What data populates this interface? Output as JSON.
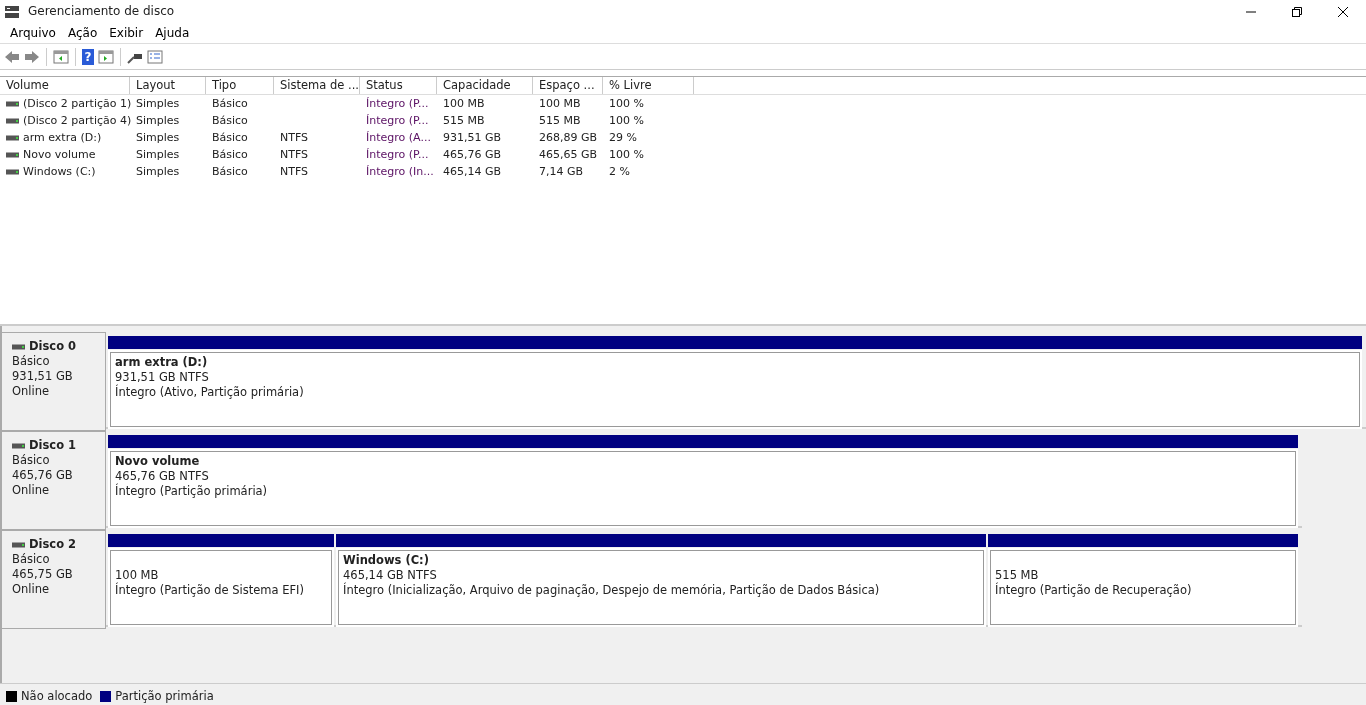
{
  "window": {
    "title": "Gerenciamento de disco"
  },
  "menu": [
    "Arquivo",
    "Ação",
    "Exibir",
    "Ajuda"
  ],
  "toolbar": {
    "help_glyph": "?"
  },
  "table": {
    "columns": [
      "Volume",
      "Layout",
      "Tipo",
      "Sistema de ...",
      "Status",
      "Capacidade",
      "Espaço ...",
      "% Livre"
    ],
    "rows": [
      [
        "(Disco 2 partição 1)",
        "Simples",
        "Básico",
        "",
        "Íntegro (P...",
        "100 MB",
        "100 MB",
        "100 %"
      ],
      [
        "(Disco 2 partição 4)",
        "Simples",
        "Básico",
        "",
        "Íntegro (P...",
        "515 MB",
        "515 MB",
        "100 %"
      ],
      [
        "arm extra (D:)",
        "Simples",
        "Básico",
        "NTFS",
        "Íntegro (A...",
        "931,51 GB",
        "268,89 GB",
        "29 %"
      ],
      [
        "Novo volume",
        "Simples",
        "Básico",
        "NTFS",
        "Íntegro (P...",
        "465,76 GB",
        "465,65 GB",
        "100 %"
      ],
      [
        "Windows  (C:)",
        "Simples",
        "Básico",
        "NTFS",
        "Íntegro (In...",
        "465,14 GB",
        "7,14 GB",
        "2 %"
      ]
    ]
  },
  "disks": [
    {
      "name": "Disco 0",
      "type": "Básico",
      "size": "931,51 GB",
      "state": "Online",
      "partitions": [
        {
          "name": "arm extra  (D:)",
          "size": "931,51 GB NTFS",
          "status": "Íntegro (Ativo, Partição primária)"
        }
      ]
    },
    {
      "name": "Disco 1",
      "type": "Básico",
      "size": "465,76 GB",
      "state": "Online",
      "partitions": [
        {
          "name": "Novo volume",
          "size": "465,76 GB NTFS",
          "status": "Íntegro (Partição primária)"
        }
      ]
    },
    {
      "name": "Disco 2",
      "type": "Básico",
      "size": "465,75 GB",
      "state": "Online",
      "partitions": [
        {
          "size": "100 MB",
          "status": "Íntegro (Partição de Sistema EFI)"
        },
        {
          "name": "Windows   (C:)",
          "size": "465,14 GB NTFS",
          "status": "Íntegro (Inicialização, Arquivo de paginação, Despejo de memória, Partição de Dados Básica)"
        },
        {
          "size": "515 MB",
          "status": "Íntegro (Partição de Recuperação)"
        }
      ]
    }
  ],
  "legend": [
    {
      "label": "Não alocado",
      "color": "#000000"
    },
    {
      "label": "Partição primária",
      "color": "#000080"
    }
  ]
}
